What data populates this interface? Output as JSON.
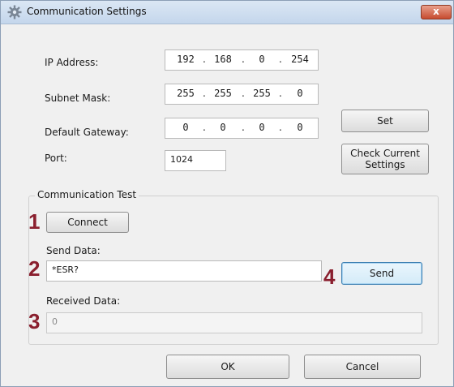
{
  "window": {
    "title": "Communication Settings",
    "close_label": "x"
  },
  "network": {
    "ip_label": "IP Address:",
    "ip": [
      "192",
      "168",
      "0",
      "254"
    ],
    "subnet_label": "Subnet Mask:",
    "subnet": [
      "255",
      "255",
      "255",
      "0"
    ],
    "gateway_label": "Default Gateway:",
    "gateway": [
      "0",
      "0",
      "0",
      "0"
    ],
    "port_label": "Port:",
    "port_value": "1024",
    "set_label": "Set",
    "check_line1": "Check Current",
    "check_line2": "Settings"
  },
  "test": {
    "group_title": "Communication Test",
    "connect_label": "Connect",
    "send_data_label": "Send Data:",
    "send_data_value": "*ESR?",
    "send_label": "Send",
    "received_label": "Received Data:",
    "received_value": "0"
  },
  "footer": {
    "ok_label": "OK",
    "cancel_label": "Cancel"
  },
  "markers": [
    "1",
    "2",
    "3",
    "4"
  ],
  "colors": {
    "marker": "#8a1f2e",
    "title_bar": "#c4d6ec",
    "close_button": "#c74b2f"
  }
}
